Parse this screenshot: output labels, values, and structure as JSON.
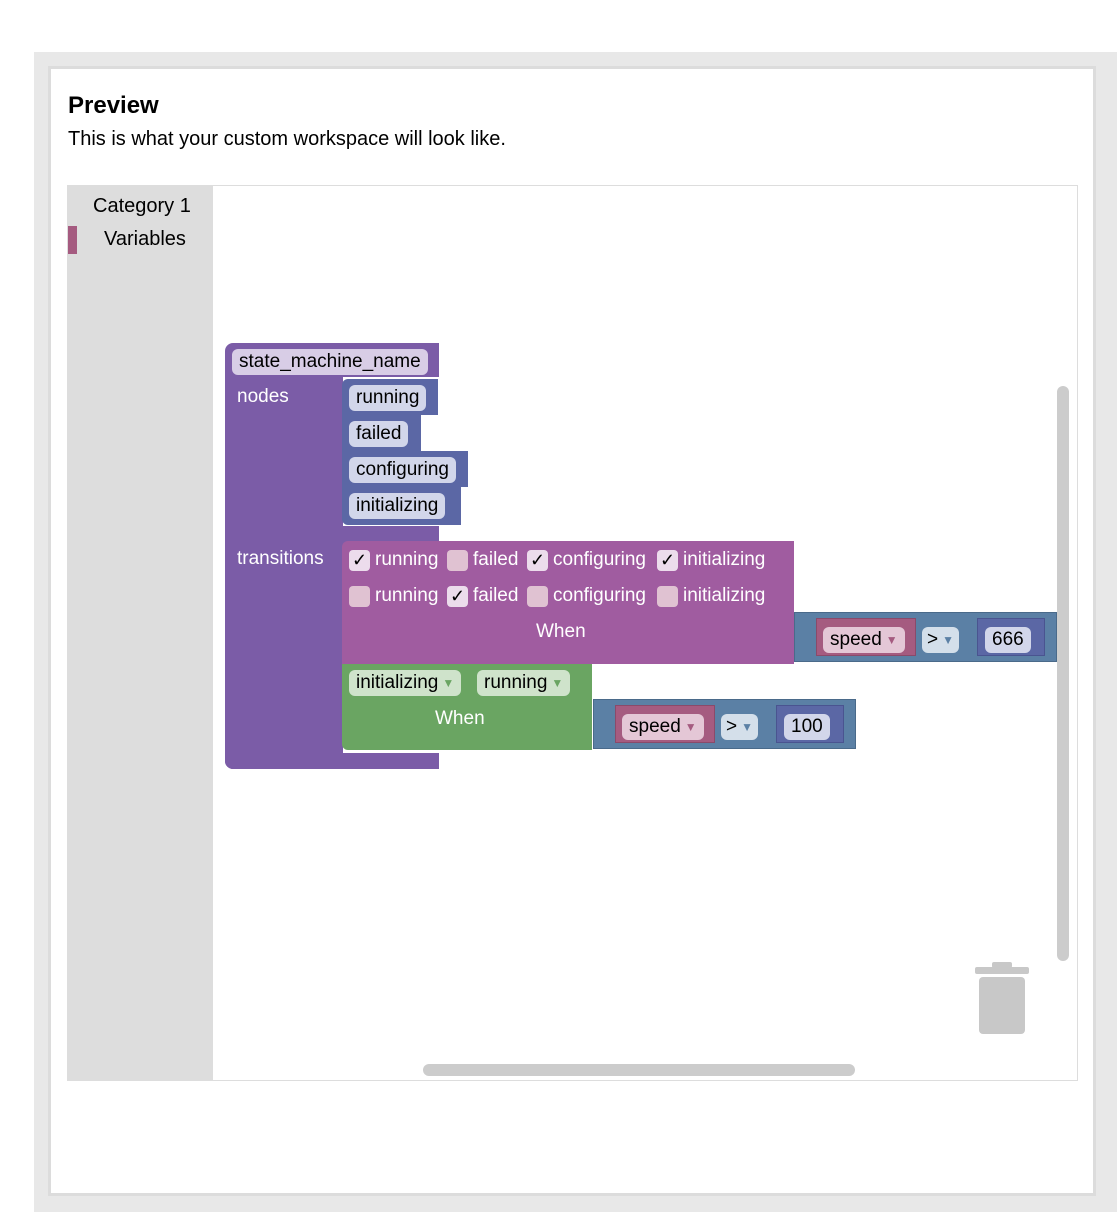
{
  "preview": {
    "title": "Preview",
    "subtitle": "This is what your custom workspace will look like."
  },
  "toolbox": {
    "categories": [
      {
        "label": "Category 1"
      },
      {
        "label": "Variables",
        "color": "#a55b80"
      }
    ]
  },
  "colors": {
    "state_machine": "#7b5ca7",
    "node_block": "#5b67a5",
    "transition_block": "#a05ca0",
    "simple_transition": "#6aa562",
    "compare_block": "#5b80a5",
    "variable_block": "#a55b80"
  },
  "state_machine": {
    "name": "state_machine_name",
    "nodes_label": "nodes",
    "transitions_label": "transitions",
    "nodes": [
      "running",
      "failed",
      "configuring",
      "initializing"
    ],
    "transition_1": {
      "from": [
        {
          "label": "running",
          "checked": true
        },
        {
          "label": "failed",
          "checked": false
        },
        {
          "label": "configuring",
          "checked": true
        },
        {
          "label": "initializing",
          "checked": true
        }
      ],
      "to": [
        {
          "label": "running",
          "checked": false
        },
        {
          "label": "failed",
          "checked": true
        },
        {
          "label": "configuring",
          "checked": false
        },
        {
          "label": "initializing",
          "checked": false
        }
      ],
      "when_label": "When",
      "condition": {
        "variable": "speed",
        "operator": ">",
        "value": "666"
      }
    },
    "transition_2": {
      "from": "initializing",
      "to": "running",
      "when_label": "When",
      "condition": {
        "variable": "speed",
        "operator": ">",
        "value": "100"
      }
    }
  },
  "icons": {
    "trash": "trash-icon",
    "dropdown": "chevron-down-icon",
    "check": "check-icon"
  }
}
